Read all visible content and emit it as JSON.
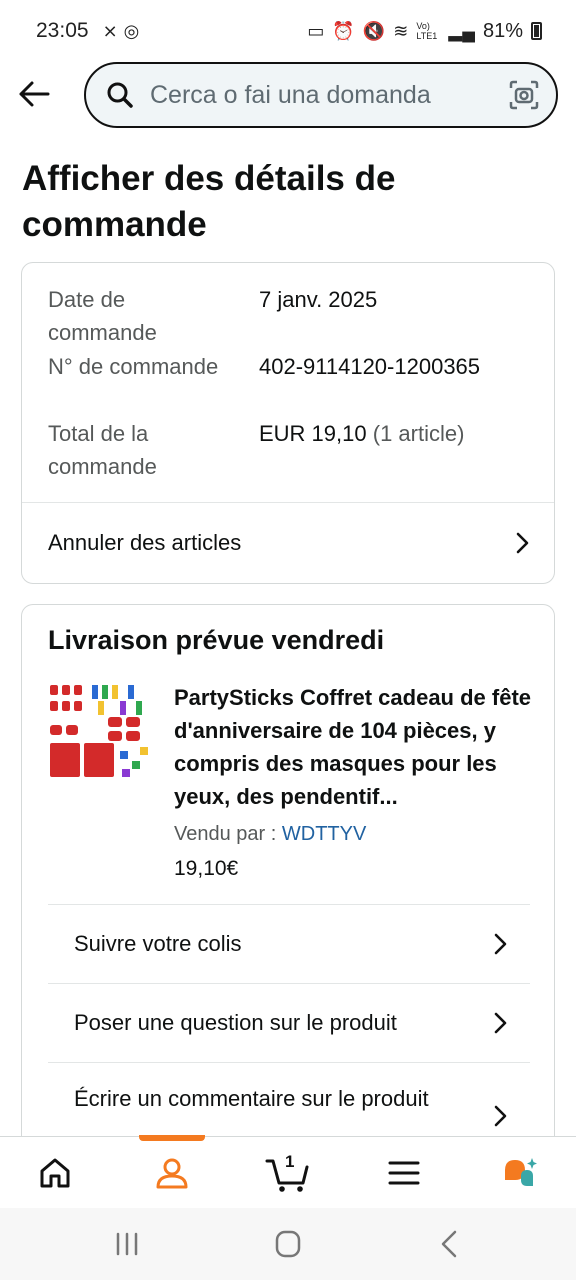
{
  "status_bar": {
    "time": "23:05",
    "battery": "81%",
    "network_label": "Vo) LTE1"
  },
  "search": {
    "placeholder": "Cerca o fai una domanda"
  },
  "page_title": "Afficher des détails de commande",
  "order_summary": {
    "rows": [
      {
        "label": "Date de commande",
        "value": "7 janv. 2025"
      },
      {
        "label": "N° de commande",
        "value": "402-9114120-1200365"
      },
      {
        "label": "Total de la commande",
        "value": "EUR 19,10",
        "extra": "(1 article)"
      }
    ],
    "cancel_label": "Annuler des articles"
  },
  "delivery": {
    "title": "Livraison prévue vendredi",
    "product_title": "PartySticks Coffret cadeau de fête d'anniversaire de 104 pièces, y compris des masques pour les yeux, des pendentif...",
    "sold_by_label": "Vendu par  :",
    "seller": "WDTTYV",
    "price": "19,10€",
    "actions": [
      {
        "label": "Suivre votre colis"
      },
      {
        "label": "Poser une question sur le produit"
      },
      {
        "label": "Écrire un commentaire sur le produit"
      }
    ]
  },
  "bottom_nav": {
    "cart_count": "1",
    "active": "account",
    "accent_color": "#f47a20"
  },
  "colors": {
    "seller_link": "#2162a1",
    "muted_text": "#565959"
  }
}
